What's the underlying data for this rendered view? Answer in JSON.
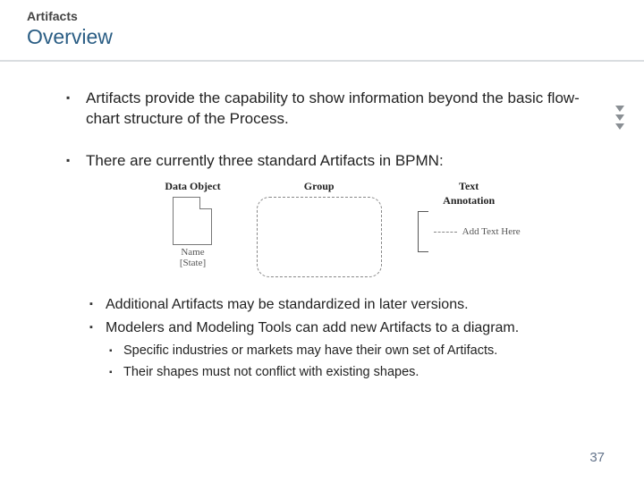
{
  "header": {
    "breadcrumb": "Artifacts",
    "title": "Overview"
  },
  "bullets": {
    "b1": "Artifacts provide the capability to show information beyond the basic flow-chart structure of the Process.",
    "b2": "There are currently three standard Artifacts in BPMN:",
    "b3": "Additional Artifacts may be standardized in later versions.",
    "b4": "Modelers and Modeling Tools can add new Artifacts to a diagram.",
    "b4a": "Specific industries or markets may have their own set of Artifacts.",
    "b4b": "Their shapes must not conflict with existing shapes."
  },
  "diagram": {
    "data_object": {
      "label": "Data Object",
      "caption_line1": "Name",
      "caption_line2": "[State]"
    },
    "group": {
      "label": "Group"
    },
    "text_annotation": {
      "label": "Text",
      "label2": "Annotation",
      "hint": "Add Text Here"
    }
  },
  "page_number": "37"
}
